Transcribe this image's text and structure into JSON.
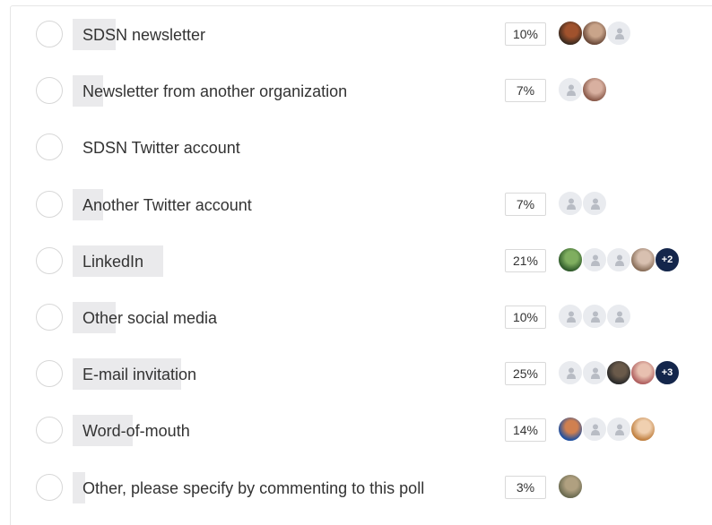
{
  "poll": {
    "options": [
      {
        "label": "SDSN newsletter",
        "percent": "10%",
        "share": 0.1,
        "voters": [
          "photo-a",
          "photo-b",
          "anon"
        ]
      },
      {
        "label": "Newsletter from another organization",
        "percent": "7%",
        "share": 0.07,
        "voters": [
          "anon",
          "photo-c"
        ]
      },
      {
        "label": "SDSN Twitter account",
        "percent": "",
        "share": 0,
        "voters": []
      },
      {
        "label": "Another Twitter account",
        "percent": "7%",
        "share": 0.07,
        "voters": [
          "anon",
          "anon"
        ]
      },
      {
        "label": "LinkedIn",
        "percent": "21%",
        "share": 0.21,
        "voters": [
          "photo-d",
          "anon",
          "anon",
          "photo-e"
        ],
        "more": "+2"
      },
      {
        "label": "Other social media",
        "percent": "10%",
        "share": 0.1,
        "voters": [
          "anon",
          "anon",
          "anon"
        ]
      },
      {
        "label": "E-mail invitation",
        "percent": "25%",
        "share": 0.25,
        "voters": [
          "anon",
          "anon",
          "photo-f",
          "photo-g"
        ],
        "more": "+3"
      },
      {
        "label": "Word-of-mouth",
        "percent": "14%",
        "share": 0.14,
        "voters": [
          "photo-h",
          "anon",
          "anon",
          "photo-i"
        ]
      },
      {
        "label": "Other, please specify by commenting to this poll",
        "percent": "3%",
        "share": 0.03,
        "voters": [
          "photo-j"
        ]
      }
    ]
  },
  "colors": {
    "bar": "#eaeaec",
    "radio_border": "#d7d7d7",
    "avatar_placeholder": "#e9ebef",
    "more_badge": "#14264b"
  },
  "avatar_colors": {
    "photo-a": [
      "#3b2a1f",
      "#a0522d"
    ],
    "photo-b": [
      "#6b4a3a",
      "#c9a48a"
    ],
    "photo-c": [
      "#8a5a4a",
      "#d8b0a0"
    ],
    "photo-d": [
      "#2f5a2a",
      "#7fae5f"
    ],
    "photo-e": [
      "#8a6f5a",
      "#d8c0b0"
    ],
    "photo-f": [
      "#2a2a2a",
      "#6a5a4a"
    ],
    "photo-g": [
      "#b06060",
      "#e8c0b0"
    ],
    "photo-h": [
      "#2050a0",
      "#d08050"
    ],
    "photo-i": [
      "#c08040",
      "#f0d0b0"
    ],
    "photo-j": [
      "#6a6a50",
      "#b0a080"
    ]
  }
}
